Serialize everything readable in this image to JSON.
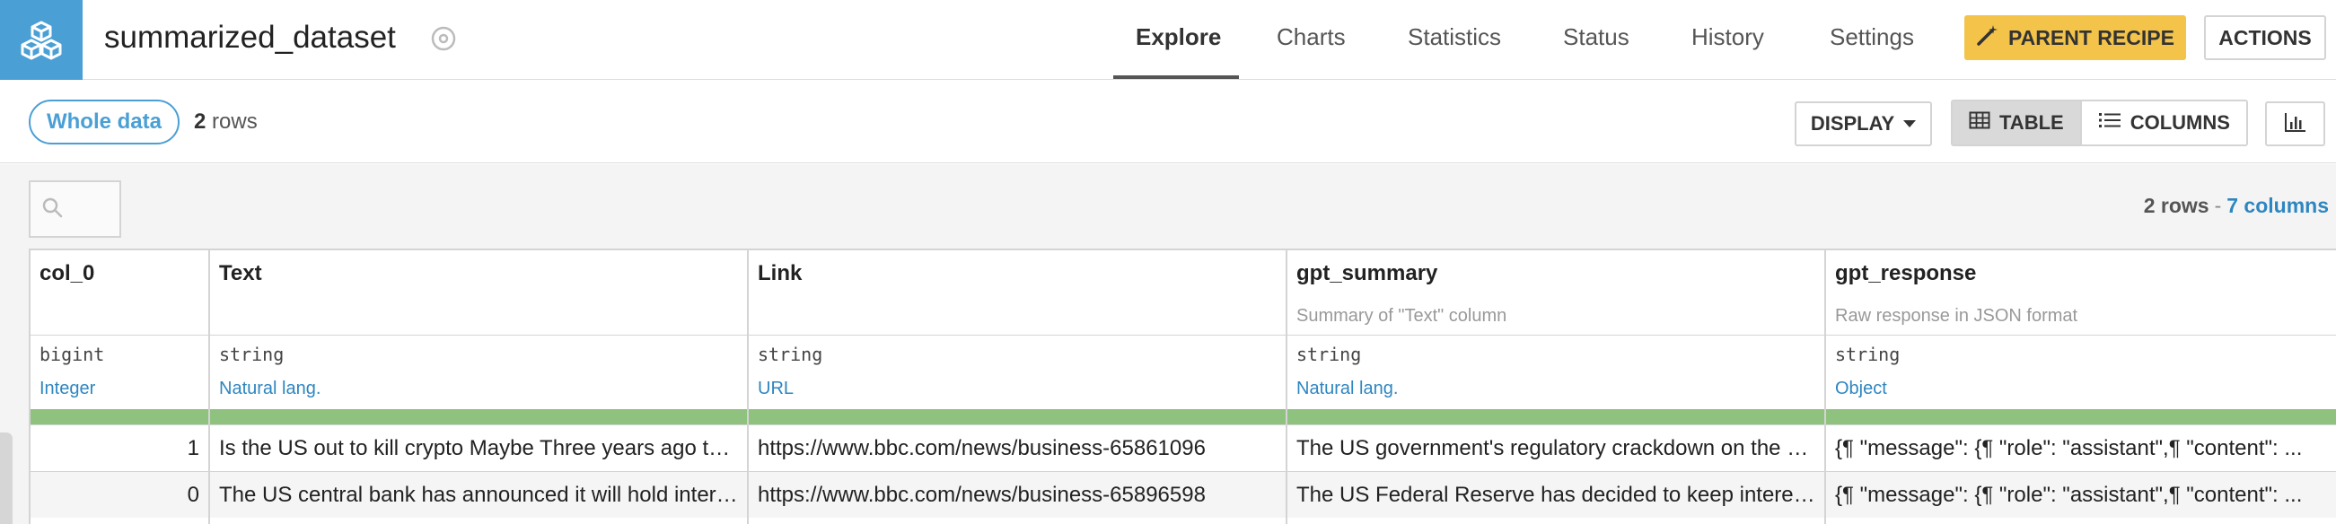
{
  "header": {
    "dataset_name": "summarized_dataset",
    "tabs": [
      {
        "label": "Explore"
      },
      {
        "label": "Charts"
      },
      {
        "label": "Statistics"
      },
      {
        "label": "Status"
      },
      {
        "label": "History"
      },
      {
        "label": "Settings"
      }
    ],
    "active_tab": "Explore",
    "parent_recipe_label": "PARENT RECIPE",
    "actions_label": "ACTIONS"
  },
  "toolbar": {
    "sample_label": "Whole data",
    "row_count": "2",
    "row_suffix": "rows",
    "display_label": "DISPLAY",
    "table_label": "TABLE",
    "columns_label": "COLUMNS"
  },
  "grid_meta": {
    "rows_text": "2 rows",
    "separator": "-",
    "columns_text": "7 columns"
  },
  "table": {
    "columns": [
      {
        "name": "col_0",
        "description": "",
        "storage_type": "bigint",
        "meaning": "Integer"
      },
      {
        "name": "Text",
        "description": "",
        "storage_type": "string",
        "meaning": "Natural lang."
      },
      {
        "name": "Link",
        "description": "",
        "storage_type": "string",
        "meaning": "URL"
      },
      {
        "name": "gpt_summary",
        "description": "Summary of \"Text\" column",
        "storage_type": "string",
        "meaning": "Natural lang."
      },
      {
        "name": "gpt_response",
        "description": "Raw response in JSON format",
        "storage_type": "string",
        "meaning": "Object"
      }
    ],
    "rows": [
      [
        "1",
        "Is the US out to kill crypto Maybe Three years ago the crypto market was booming",
        "https://www.bbc.com/news/business-65861096",
        "The US government's regulatory crackdown on the crypto industry",
        "{¶  \"message\": {¶    \"role\": \"assistant\",¶    \"content\": ..."
      ],
      [
        "0",
        "The US central bank has announced it will hold interest rates",
        "https://www.bbc.com/news/business-65896598",
        "The US Federal Reserve has decided to keep interest rates",
        "{¶  \"message\": {¶    \"role\": \"assistant\",¶    \"content\": ..."
      ]
    ]
  },
  "colors": {
    "brand": "#4a9fd5",
    "parent_recipe": "#f4c44a",
    "quality_ok": "#8fc27f",
    "link_blue": "#2e86c1"
  }
}
